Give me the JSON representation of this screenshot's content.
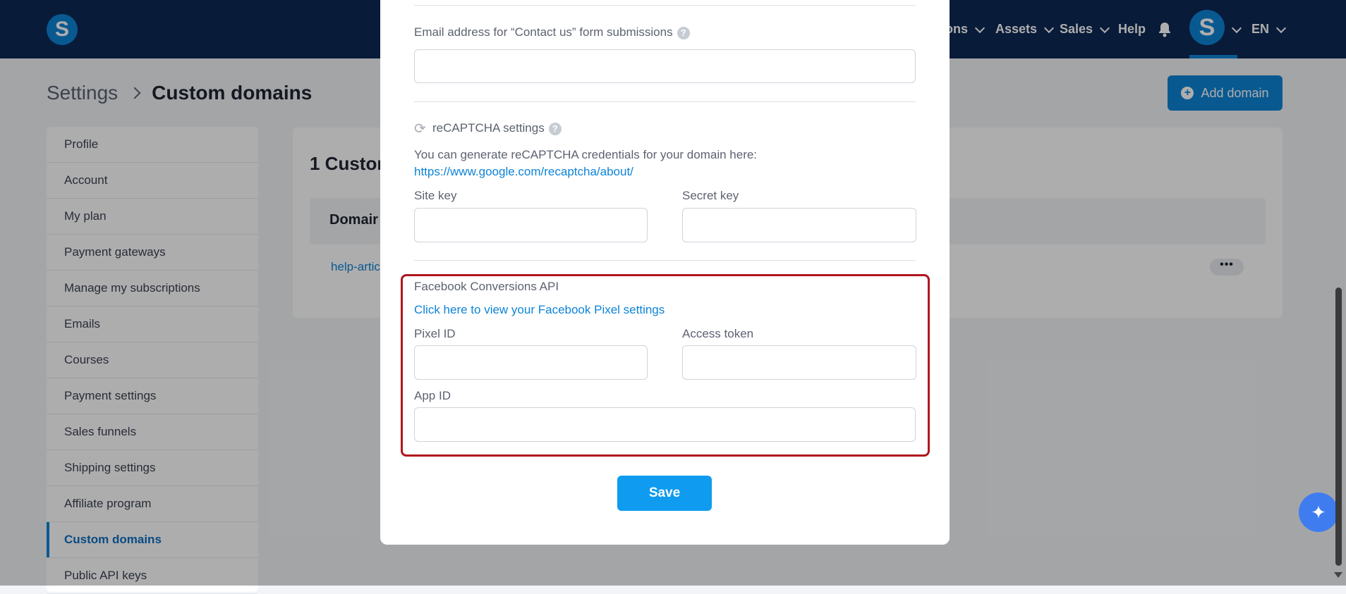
{
  "header": {
    "logo_letter": "S",
    "nav": [
      {
        "label": "ons"
      },
      {
        "label": "Assets"
      },
      {
        "label": "Sales"
      },
      {
        "label": "Help"
      }
    ],
    "avatar_letter": "S",
    "language": "EN"
  },
  "breadcrumb": {
    "parent": "Settings",
    "current": "Custom domains"
  },
  "add_domain_label": "Add domain",
  "sidebar": {
    "items": [
      {
        "label": "Profile"
      },
      {
        "label": "Account"
      },
      {
        "label": "My plan"
      },
      {
        "label": "Payment gateways"
      },
      {
        "label": "Manage my subscriptions"
      },
      {
        "label": "Emails"
      },
      {
        "label": "Courses"
      },
      {
        "label": "Payment settings"
      },
      {
        "label": "Sales funnels"
      },
      {
        "label": "Shipping settings"
      },
      {
        "label": "Affiliate program"
      },
      {
        "label": "Custom domains"
      },
      {
        "label": "Public API keys"
      }
    ]
  },
  "panel": {
    "title": "1 Custor",
    "column_header": "Domair",
    "row_link": "help-artic"
  },
  "modal": {
    "contact_email_label": "Email address for “Contact us” form submissions",
    "contact_email_value": "",
    "recaptcha": {
      "title": "reCAPTCHA settings",
      "help_text": "You can generate reCAPTCHA credentials for your domain here:",
      "link": "https://www.google.com/recaptcha/about/",
      "site_key_label": "Site key",
      "secret_key_label": "Secret key",
      "site_key_value": "",
      "secret_key_value": ""
    },
    "facebook": {
      "title": "Facebook Conversions API",
      "link": "Click here to view your Facebook Pixel settings",
      "pixel_id_label": "Pixel ID",
      "access_token_label": "Access token",
      "app_id_label": "App ID",
      "pixel_id_value": "",
      "access_token_value": "",
      "app_id_value": ""
    },
    "save_label": "Save"
  },
  "colors": {
    "brand_dark": "#0d2954",
    "accent": "#0e83d6",
    "highlight_border": "#b0161d",
    "save": "#0e9bf0"
  }
}
